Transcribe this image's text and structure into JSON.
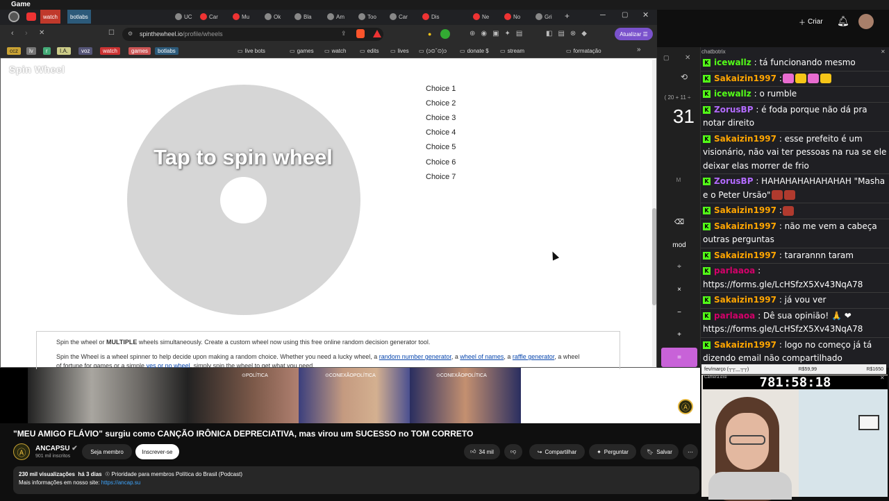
{
  "window": {
    "title": "Game"
  },
  "browser": {
    "tabs": [
      {
        "label": "watch",
        "color": "#c33"
      },
      {
        "label": "botlabs",
        "color": "#4a7a9a"
      },
      {
        "label": "UC",
        "color": "#888"
      },
      {
        "label": "Car",
        "color": "#e33"
      },
      {
        "label": "Mu",
        "color": "#e33"
      },
      {
        "label": "Ok",
        "color": "#888"
      },
      {
        "label": "Bla",
        "color": "#888"
      },
      {
        "label": "Am",
        "color": "#888"
      },
      {
        "label": "Too",
        "color": "#888"
      },
      {
        "label": "Car",
        "color": "#888"
      },
      {
        "label": "Dis",
        "color": "#e33"
      },
      {
        "label": "Ne",
        "color": "#e33"
      },
      {
        "label": "No",
        "color": "#e33"
      },
      {
        "label": "Gri",
        "color": "#888"
      }
    ],
    "url_domain": "spinthewheel.io",
    "url_path": "/profile/wheels",
    "update_label": "Atualizar",
    "bookmarks": [
      "ccz",
      "lv",
      "r",
      "I.A.",
      "voz",
      "watch",
      "games",
      "botlabs",
      "live bots",
      "games",
      "watch",
      "edits",
      "lives",
      "(ↄ⊙ˇ⊙)ↄ",
      "donate $",
      "stream",
      "formatação"
    ]
  },
  "page": {
    "logo": "Spin Wheel",
    "wheel_prompt": "Tap to spin wheel",
    "choices": [
      "Choice 1",
      "Choice 2",
      "Choice 3",
      "Choice 4",
      "Choice 5",
      "Choice 6",
      "Choice 7"
    ],
    "info_line1_pre": "Spin the wheel or ",
    "info_line1_bold": "MULTIPLE",
    "info_line1_post": " wheels simultaneously. Create a custom wheel now using this free online random decision generator tool.",
    "info_line2_pre": "Spin the Wheel is a wheel spinner to help decide upon making a random choice. Whether you need a lucky wheel, a ",
    "info_link1": "random number generator",
    "info_mid1": ", a ",
    "info_link2": "wheel of names",
    "info_mid2": ", a ",
    "info_link3": "raffle generator",
    "info_line2_post": ", a wheel",
    "info_line3_pre": "of fortune for games or a simple ",
    "info_link4": "yes or no wheel",
    "info_line3_post": ", simply spin the wheel to get what you need."
  },
  "calculator": {
    "expression": "( 20 + 11 ÷",
    "result": "31",
    "memory": "M",
    "buttons": [
      "⌫",
      "mod",
      "÷",
      "×",
      "−",
      "+",
      "="
    ]
  },
  "chat": {
    "header": "chatbotrix",
    "messages": [
      {
        "user": "icewallz",
        "color": "#53fc18",
        "text": ": tá funcionando mesmo"
      },
      {
        "user": "Sakaizin1997",
        "color": "#ffa500",
        "text": ":",
        "emotes": 4
      },
      {
        "user": "icewallz",
        "color": "#53fc18",
        "text": ": o rumble"
      },
      {
        "user": "ZorusBP",
        "color": "#b36bff",
        "text": ": é foda porque não dá pra notar direito"
      },
      {
        "user": "Sakaizin1997",
        "color": "#ffa500",
        "text": ": esse prefeito é um visionário, não vai ter pessoas na rua se ele deixar elas morrer de frio"
      },
      {
        "user": "ZorusBP",
        "color": "#b36bff",
        "text": ": HAHAHAHAHAHAHAH \"Masha e o Peter Ursão\"",
        "emotes": 2
      },
      {
        "user": "Sakaizin1997",
        "color": "#ffa500",
        "text": ":",
        "emotes": 1
      },
      {
        "user": "Sakaizin1997",
        "color": "#ffa500",
        "text": ": não me vem a cabeça outras perguntas"
      },
      {
        "user": "Sakaizin1997",
        "color": "#ffa500",
        "text": ": tararannn taram"
      },
      {
        "user": "parlaaoa",
        "color": "#d4006a",
        "text": ": https://forms.gle/LcHSfzX5Xv43NqA78"
      },
      {
        "user": "Sakaizin1997",
        "color": "#ffa500",
        "text": ": já vou ver"
      },
      {
        "user": "parlaaoa",
        "color": "#d4006a",
        "text": ": Dê sua opinião! 🙏 ❤ https://forms.gle/LcHSfzX5Xv43NqA78"
      },
      {
        "user": "Sakaizin1997",
        "color": "#ffa500",
        "text": ": logo no começo já tá dizendo email não compartilhado"
      }
    ]
  },
  "budget": {
    "left": "fev/março (┬┬﹏┬┬)",
    "mid": "R$59,99",
    "right": "R$1650"
  },
  "webcam": {
    "title": "Câmera.exe",
    "timer": "781:58:18"
  },
  "youtube": {
    "create_label": "Criar",
    "video_title": "\"MEU AMIGO FLÁVIO\" surgiu como CANÇÃO IRÔNICA DEPRECIATIVA, mas virou um SUCESSO no TOM CORRETO",
    "channel": "ANCAPSU",
    "subs": "901 mil inscritos",
    "member_label": "Seja membro",
    "subscribe_label": "Inscrever-se",
    "likes": "34 mil",
    "share_label": "Compartilhar",
    "ask_label": "Perguntar",
    "save_label": "Salvar",
    "views": "230 mil visualizações",
    "age": "há 3 dias",
    "desc_tags": "☉ Prioridade para membros  Política do Brasil (Podcast)",
    "more_info": "Mais informações em nosso site: ",
    "more_info_link": "https://ancap.su",
    "thumb_labels": [
      "⊙POLÍTICA",
      "⊙CONEXÃOPOLÍTICA",
      "⊙CONEXÃOPOLÍTICA"
    ]
  }
}
